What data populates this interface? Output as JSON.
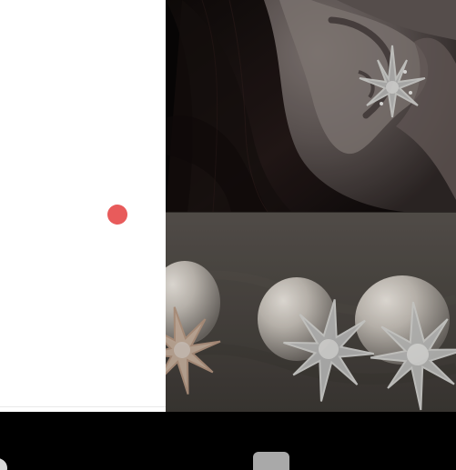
{
  "colors": {
    "background": "#000000",
    "panel": "#ffffff",
    "notification_dot": "#e85b5b",
    "navigation_bar": "#000000"
  },
  "icons": {
    "notification_dot": "red-dot-icon",
    "back": "back-nav-icon",
    "home": "home-nav-icon"
  },
  "images": {
    "top": "earring-on-ear-photo",
    "bottom": "pearl-star-earrings-photo"
  }
}
